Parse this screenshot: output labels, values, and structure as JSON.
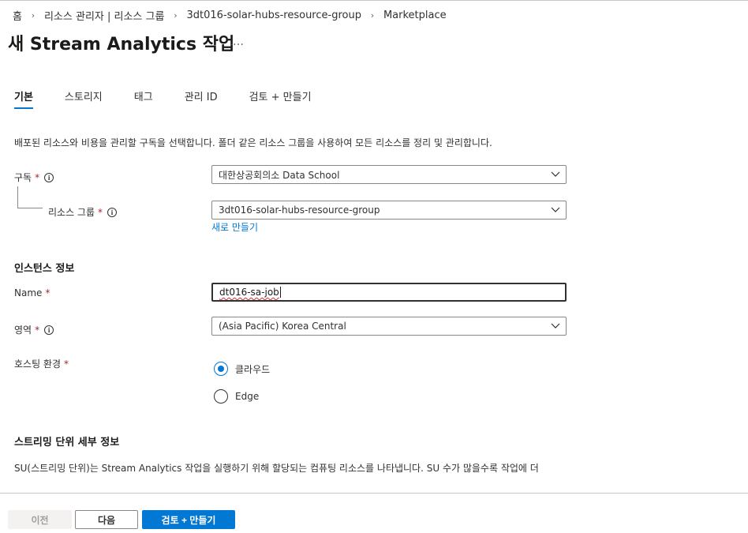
{
  "breadcrumb": {
    "items": [
      "홈",
      "리소스 관리자 | 리소스 그룹",
      "3dt016-solar-hubs-resource-group",
      "Marketplace"
    ]
  },
  "page": {
    "title": "새 Stream Analytics 작업",
    "more_label": "…"
  },
  "tabs": [
    {
      "label": "기본",
      "active": true
    },
    {
      "label": "스토리지",
      "active": false
    },
    {
      "label": "태그",
      "active": false
    },
    {
      "label": "관리 ID",
      "active": false
    },
    {
      "label": "검토 + 만들기",
      "active": false
    }
  ],
  "project": {
    "description": "배포된 리소스와 비용을 관리할 구독을 선택합니다. 폴더 같은 리소스 그룹을 사용하여 모든 리소스를 정리 및 관리합니다.",
    "subscription_label": "구독",
    "subscription_value": "대한상공회의소 Data School",
    "resource_group_label": "리소스 그룹",
    "resource_group_value": "3dt016-solar-hubs-resource-group",
    "create_new_link": "새로 만들기"
  },
  "instance": {
    "section_title": "인스턴스 정보",
    "name_label": "Name",
    "name_value": "dt016-sa-job",
    "region_label": "영역",
    "region_value": "(Asia Pacific) Korea Central",
    "hosting_label": "호스팅 환경",
    "hosting_options": [
      {
        "label": "클라우드",
        "selected": true
      },
      {
        "label": "Edge",
        "selected": false
      }
    ]
  },
  "streaming": {
    "section_title": "스트리밍 단위 세부 정보",
    "description": "SU(스트리밍 단위)는 Stream Analytics 작업을 실행하기 위해 할당되는 컴퓨팅 리소스를 나타냅니다. SU 수가 많을수록 작업에 더"
  },
  "required_marker": "*",
  "info_glyph": "i",
  "footer": {
    "prev_label": "이전",
    "next_label": "다음",
    "review_label": "검토 + 만들기"
  },
  "colors": {
    "accent": "#0078d4",
    "required": "#a4262c",
    "text": "#323130",
    "disabled_text": "#a19f9d"
  }
}
